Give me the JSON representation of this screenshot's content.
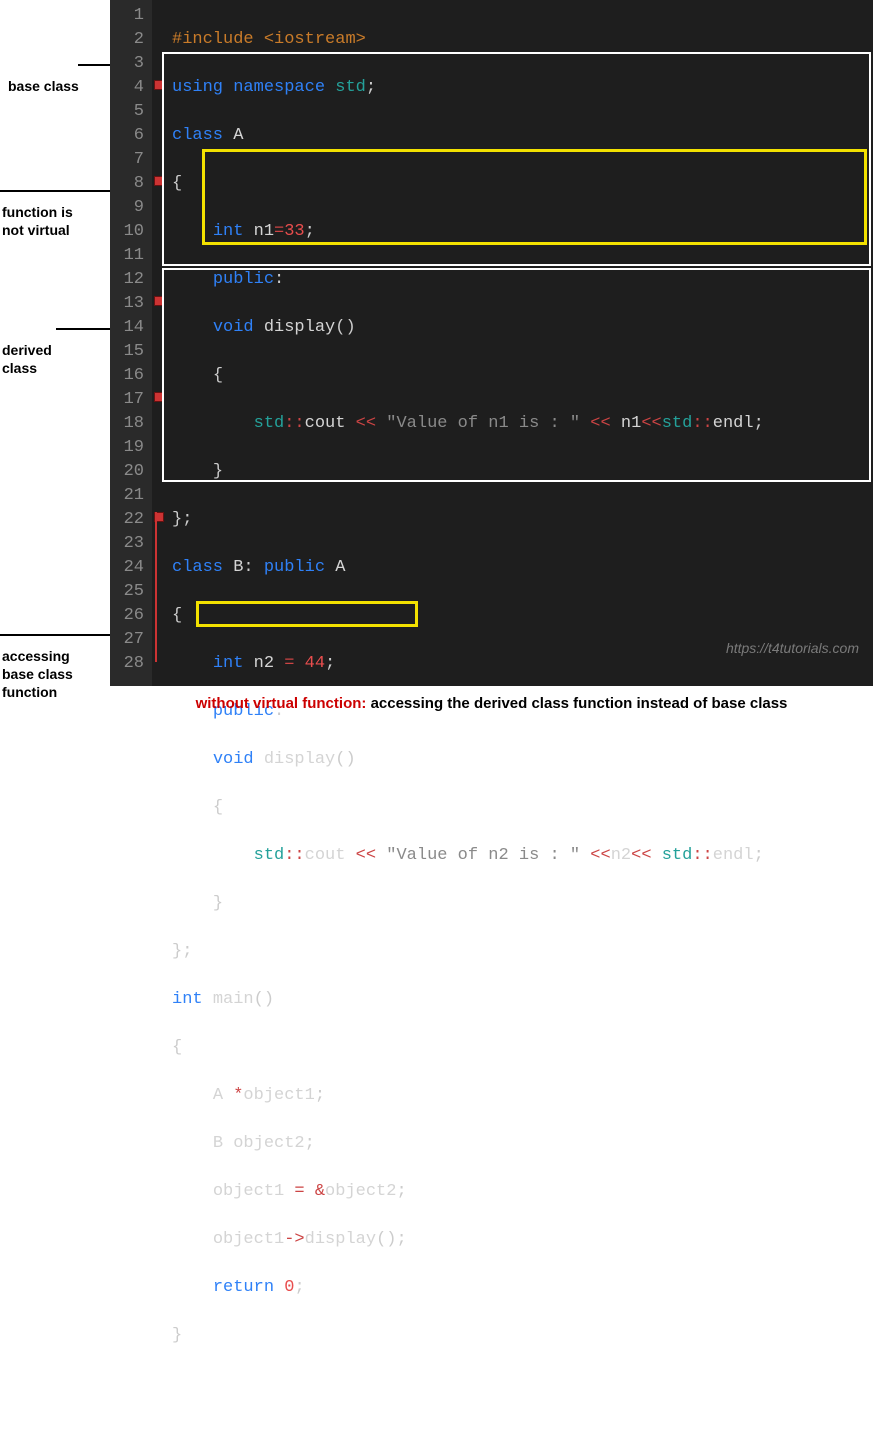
{
  "labels": {
    "base_class": "base class",
    "not_virtual_1": "function is",
    "not_virtual_2": "not virtual",
    "derived_class_1": "derived",
    "derived_class_2": "class",
    "accessing_1": "accessing",
    "accessing_2": "base class",
    "accessing_3": "function"
  },
  "line_numbers": [
    "1",
    "2",
    "3",
    "4",
    "5",
    "6",
    "7",
    "8",
    "9",
    "10",
    "11",
    "12",
    "13",
    "14",
    "15",
    "16",
    "17",
    "18",
    "19",
    "20",
    "21",
    "22",
    "23",
    "24",
    "25",
    "26",
    "27",
    "28"
  ],
  "code": {
    "l1": {
      "pre1": "#include",
      "pre2": " <iostream>"
    },
    "l2": {
      "kw1": "using",
      "kw2": "namespace",
      "t": "std",
      "p": ";"
    },
    "l3": {
      "kw": "class",
      "id": "A"
    },
    "l4": {
      "p": "{"
    },
    "l5": {
      "kw": "int",
      "id": "n1",
      "op": "=",
      "num": "33",
      "p": ";"
    },
    "l6": {
      "kw": "public",
      "p": ":"
    },
    "l7": {
      "kw": "void",
      "id": "display",
      "p": "()"
    },
    "l8": {
      "p": "{"
    },
    "l9": {
      "ns": "std",
      "op1": "::",
      "cout": "cout",
      "op2": " << ",
      "str": "\"Value of n1 is : \"",
      "op3": " << ",
      "id": "n1",
      "op4": "<<",
      "ns2": "std",
      "op5": "::",
      "endl": "endl",
      "p": ";"
    },
    "l10": {
      "p": "}"
    },
    "l11": {
      "p": "};"
    },
    "l12": {
      "kw": "class",
      "id": "B",
      "p1": ":",
      "kw2": "public",
      "id2": "A"
    },
    "l13": {
      "p": "{"
    },
    "l14": {
      "kw": "int",
      "id": "n2",
      "op": " = ",
      "num": "44",
      "p": ";"
    },
    "l15": {
      "kw": "public",
      "p": ":"
    },
    "l16": {
      "kw": "void",
      "id": "display",
      "p": "()"
    },
    "l17": {
      "p": "{"
    },
    "l18": {
      "ns": "std",
      "op1": "::",
      "cout": "cout",
      "op2": " << ",
      "str": "\"Value of n2 is : \"",
      "op3": " <<",
      "id": "n2",
      "op4": "<< ",
      "ns2": "std",
      "op5": "::",
      "endl": "endl",
      "p": ";"
    },
    "l19": {
      "p": "}"
    },
    "l20": {
      "p": "};"
    },
    "l21": {
      "kw": "int",
      "id": "main",
      "p": "()"
    },
    "l22": {
      "p": "{"
    },
    "l23": {
      "id1": "A",
      "op": " *",
      "id2": "object1",
      "p": ";"
    },
    "l24": {
      "id1": "B",
      "id2": " object2",
      "p": ";"
    },
    "l25": {
      "id1": "object1",
      "op1": " = ",
      "op2": "&",
      "id2": "object2",
      "p": ";"
    },
    "l26": {
      "id1": "object1",
      "op": "->",
      "id2": "display",
      "p": "();"
    },
    "l27": {
      "kw": "return",
      "num": " 0",
      "p": ";"
    },
    "l28": {
      "p": "}"
    }
  },
  "watermark": "https://t4tutorials.com",
  "caption": {
    "red": "without virtual function: ",
    "black": "accessing the derived class function instead of base class"
  }
}
